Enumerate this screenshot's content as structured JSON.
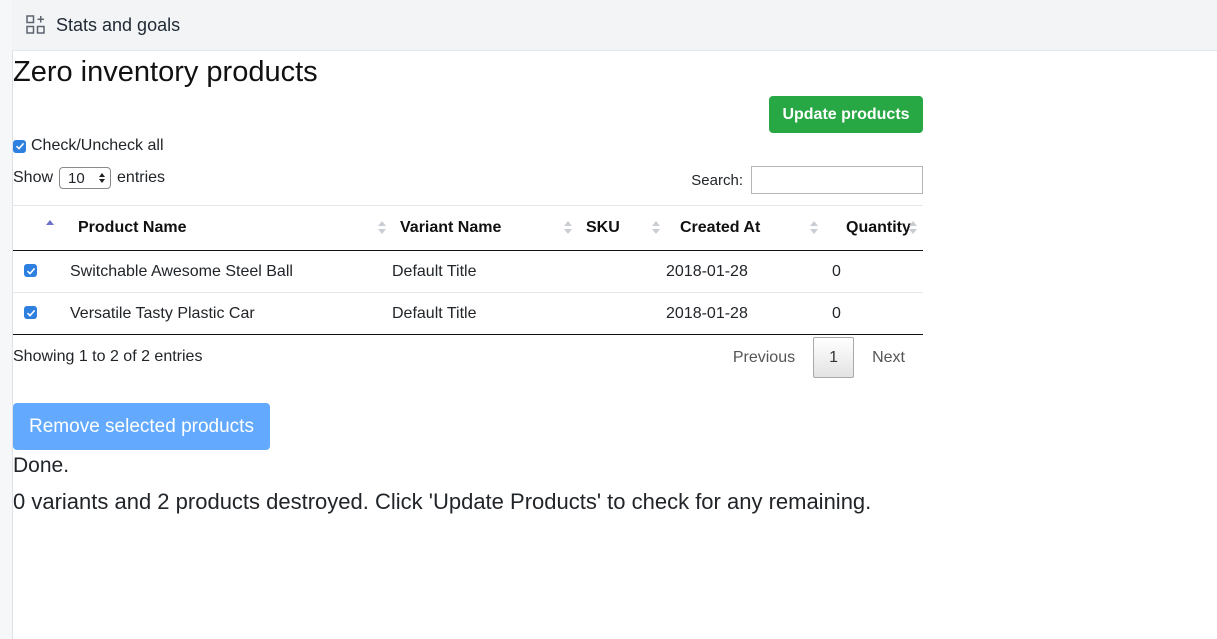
{
  "header": {
    "title": "Stats and goals"
  },
  "page": {
    "title": "Zero inventory products"
  },
  "update_button": {
    "label": "Update products"
  },
  "check_all": {
    "label": "Check/Uncheck all"
  },
  "length": {
    "show": "Show",
    "value": "10",
    "entries": "entries"
  },
  "search": {
    "label": "Search:"
  },
  "table": {
    "columns": [
      "Product Name",
      "Variant Name",
      "SKU",
      "Created At",
      "Quantity"
    ],
    "rows": [
      {
        "name": "Switchable Awesome Steel Ball",
        "variant": "Default Title",
        "sku": "",
        "created": "2018-01-28",
        "qty": "0"
      },
      {
        "name": "Versatile Tasty Plastic Car",
        "variant": "Default Title",
        "sku": "",
        "created": "2018-01-28",
        "qty": "0"
      }
    ]
  },
  "info": {
    "text": "Showing 1 to 2 of 2 entries"
  },
  "pagination": {
    "previous": "Previous",
    "page": "1",
    "next": "Next"
  },
  "remove_button": {
    "label": "Remove selected products"
  },
  "status": {
    "done": "Done.",
    "message": "0 variants and 2 products destroyed. Click 'Update Products' to check for any remaining."
  },
  "colors": {
    "update_btn": "#28a745",
    "remove_btn": "#63aaff",
    "checkbox": "#2d7fe0"
  },
  "icons": {
    "header": "apps-add-icon",
    "checkbox": "check-icon",
    "sort": "sort-icon"
  }
}
